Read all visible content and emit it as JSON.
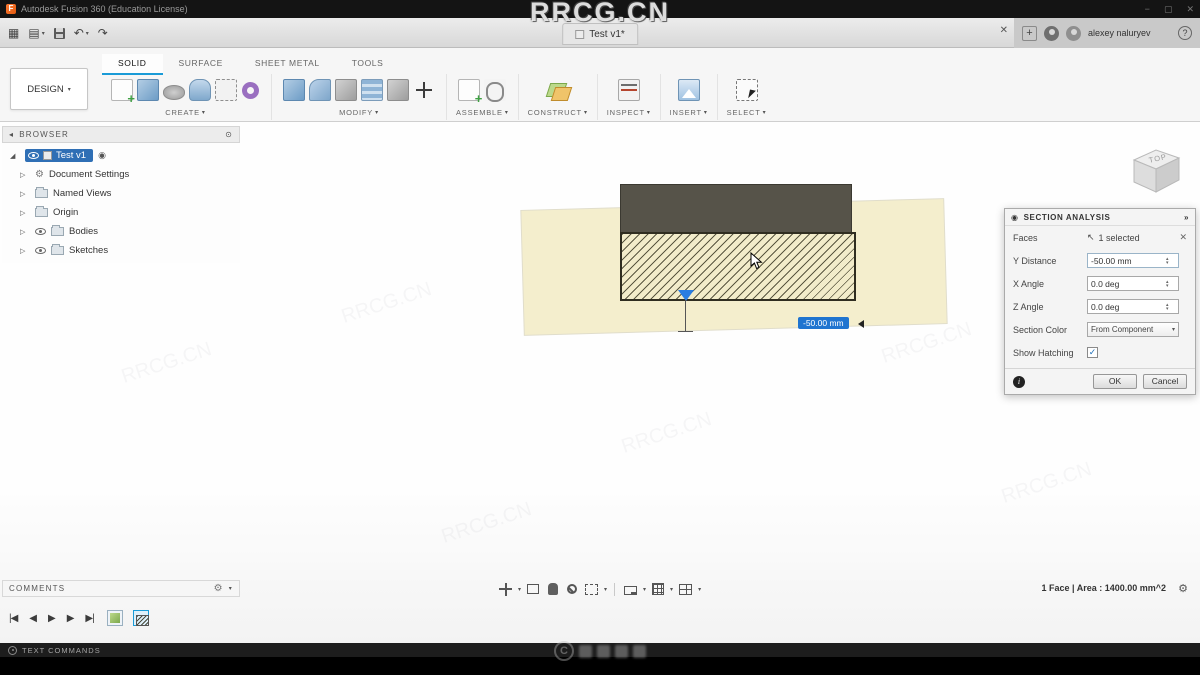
{
  "icons": {
    "caret": "▾",
    "close": "✕",
    "add": "+",
    "help": "?",
    "grid": "▦",
    "doc": "▤",
    "undo": "↶",
    "redo": "↷",
    "expander": "▷",
    "expander_open": "◢",
    "radio": "◉",
    "gear": "⚙",
    "collapse_left": "◂",
    "target": "⊙",
    "cursor_ne": "↖",
    "check": "✓",
    "spin_up": "▴",
    "spin_down": "▾",
    "chevrons": "»",
    "min": "−",
    "max": "▢",
    "dialog_eye": "◉"
  },
  "watermark": {
    "brand": "RRCG.CN"
  },
  "titlebar": {
    "title": "Autodesk Fusion 360 (Education License)"
  },
  "qat": {
    "tab_label": "Test v1*",
    "user": "alexey naluryev"
  },
  "ribbon": {
    "design": "DESIGN",
    "tabs": [
      {
        "label": "SOLID"
      },
      {
        "label": "SURFACE"
      },
      {
        "label": "SHEET METAL"
      },
      {
        "label": "TOOLS"
      }
    ],
    "groups": [
      {
        "label": "CREATE"
      },
      {
        "label": "MODIFY"
      },
      {
        "label": "ASSEMBLE"
      },
      {
        "label": "CONSTRUCT"
      },
      {
        "label": "INSPECT"
      },
      {
        "label": "INSERT"
      },
      {
        "label": "SELECT"
      }
    ]
  },
  "browser": {
    "title": "BROWSER",
    "items": [
      {
        "label": "Test v1"
      },
      {
        "label": "Document Settings"
      },
      {
        "label": "Named Views"
      },
      {
        "label": "Origin"
      },
      {
        "label": "Bodies"
      },
      {
        "label": "Sketches"
      }
    ]
  },
  "viewcube": {
    "top_label": "TOP"
  },
  "canvas": {
    "dimension_label": "-50.00 mm"
  },
  "dialog": {
    "title": "SECTION ANALYSIS",
    "faces_label": "Faces",
    "faces_value": "1 selected",
    "y_distance_label": "Y Distance",
    "y_distance_value": "-50.00 mm",
    "x_angle_label": "X Angle",
    "x_angle_value": "0.0 deg",
    "z_angle_label": "Z Angle",
    "z_angle_value": "0.0 deg",
    "section_color_label": "Section Color",
    "section_color_value": "From Component",
    "show_hatching_label": "Show Hatching",
    "show_hatching_checked": true,
    "ok": "OK",
    "cancel": "Cancel"
  },
  "comments": {
    "title": "COMMENTS"
  },
  "status": {
    "selection": "1 Face | Area : 1400.00 mm^2"
  },
  "timeline": {
    "transport": [
      "|◀",
      "◀",
      "▶",
      "▶",
      "▶|"
    ]
  },
  "textcmd": {
    "label": "TEXT COMMANDS"
  },
  "colors": {
    "accent": "#1a9bd7",
    "selection": "#2f6fb5",
    "plane": "#f4eecd",
    "section_dark": "#565349"
  }
}
